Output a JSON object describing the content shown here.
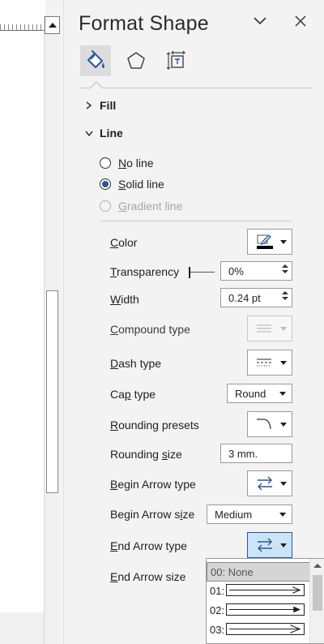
{
  "pane": {
    "title": "Format Shape",
    "tabs": [
      "Fill & Line",
      "Effects",
      "Size & Properties"
    ]
  },
  "sections": {
    "fill": "Fill",
    "line": "Line"
  },
  "line_options": [
    {
      "label": "No line",
      "selected": false,
      "enabled": true
    },
    {
      "label": "Solid line",
      "selected": true,
      "enabled": true
    },
    {
      "label": "Gradient line",
      "selected": false,
      "enabled": false
    }
  ],
  "props": {
    "color": {
      "label": "Color",
      "swatch": "#000000"
    },
    "transparency": {
      "label": "Transparency",
      "value": "0%",
      "level": 0
    },
    "width": {
      "label": "Width",
      "value": "0.24 pt"
    },
    "compound_type": {
      "label": "Compound type"
    },
    "dash_type": {
      "label": "Dash type"
    },
    "cap_type": {
      "label": "Cap type",
      "value": "Round"
    },
    "rounding_presets": {
      "label": "Rounding presets"
    },
    "rounding_size": {
      "label": "Rounding size",
      "value": "3 mm."
    },
    "begin_arrow_type": {
      "label": "Begin Arrow type"
    },
    "begin_arrow_size": {
      "label": "Begin Arrow size",
      "value": "Medium"
    },
    "end_arrow_type": {
      "label": "End Arrow type"
    },
    "end_arrow_size": {
      "label": "End Arrow size"
    }
  },
  "arrow_list": [
    {
      "code": "00: None",
      "selected": true
    },
    {
      "code": "01:",
      "selected": false
    },
    {
      "code": "02:",
      "selected": false
    },
    {
      "code": "03:",
      "selected": false
    }
  ],
  "colors": {
    "accent": "#2b579a",
    "active_bg": "#cce4f7",
    "pane_bg": "#f3f3f3"
  },
  "icons": {
    "fill_line_tab": "paint-bucket-icon",
    "effects_tab": "pentagon-icon",
    "size_tab": "size-properties-icon",
    "collapse": "chevron-down-icon",
    "close": "close-icon"
  }
}
